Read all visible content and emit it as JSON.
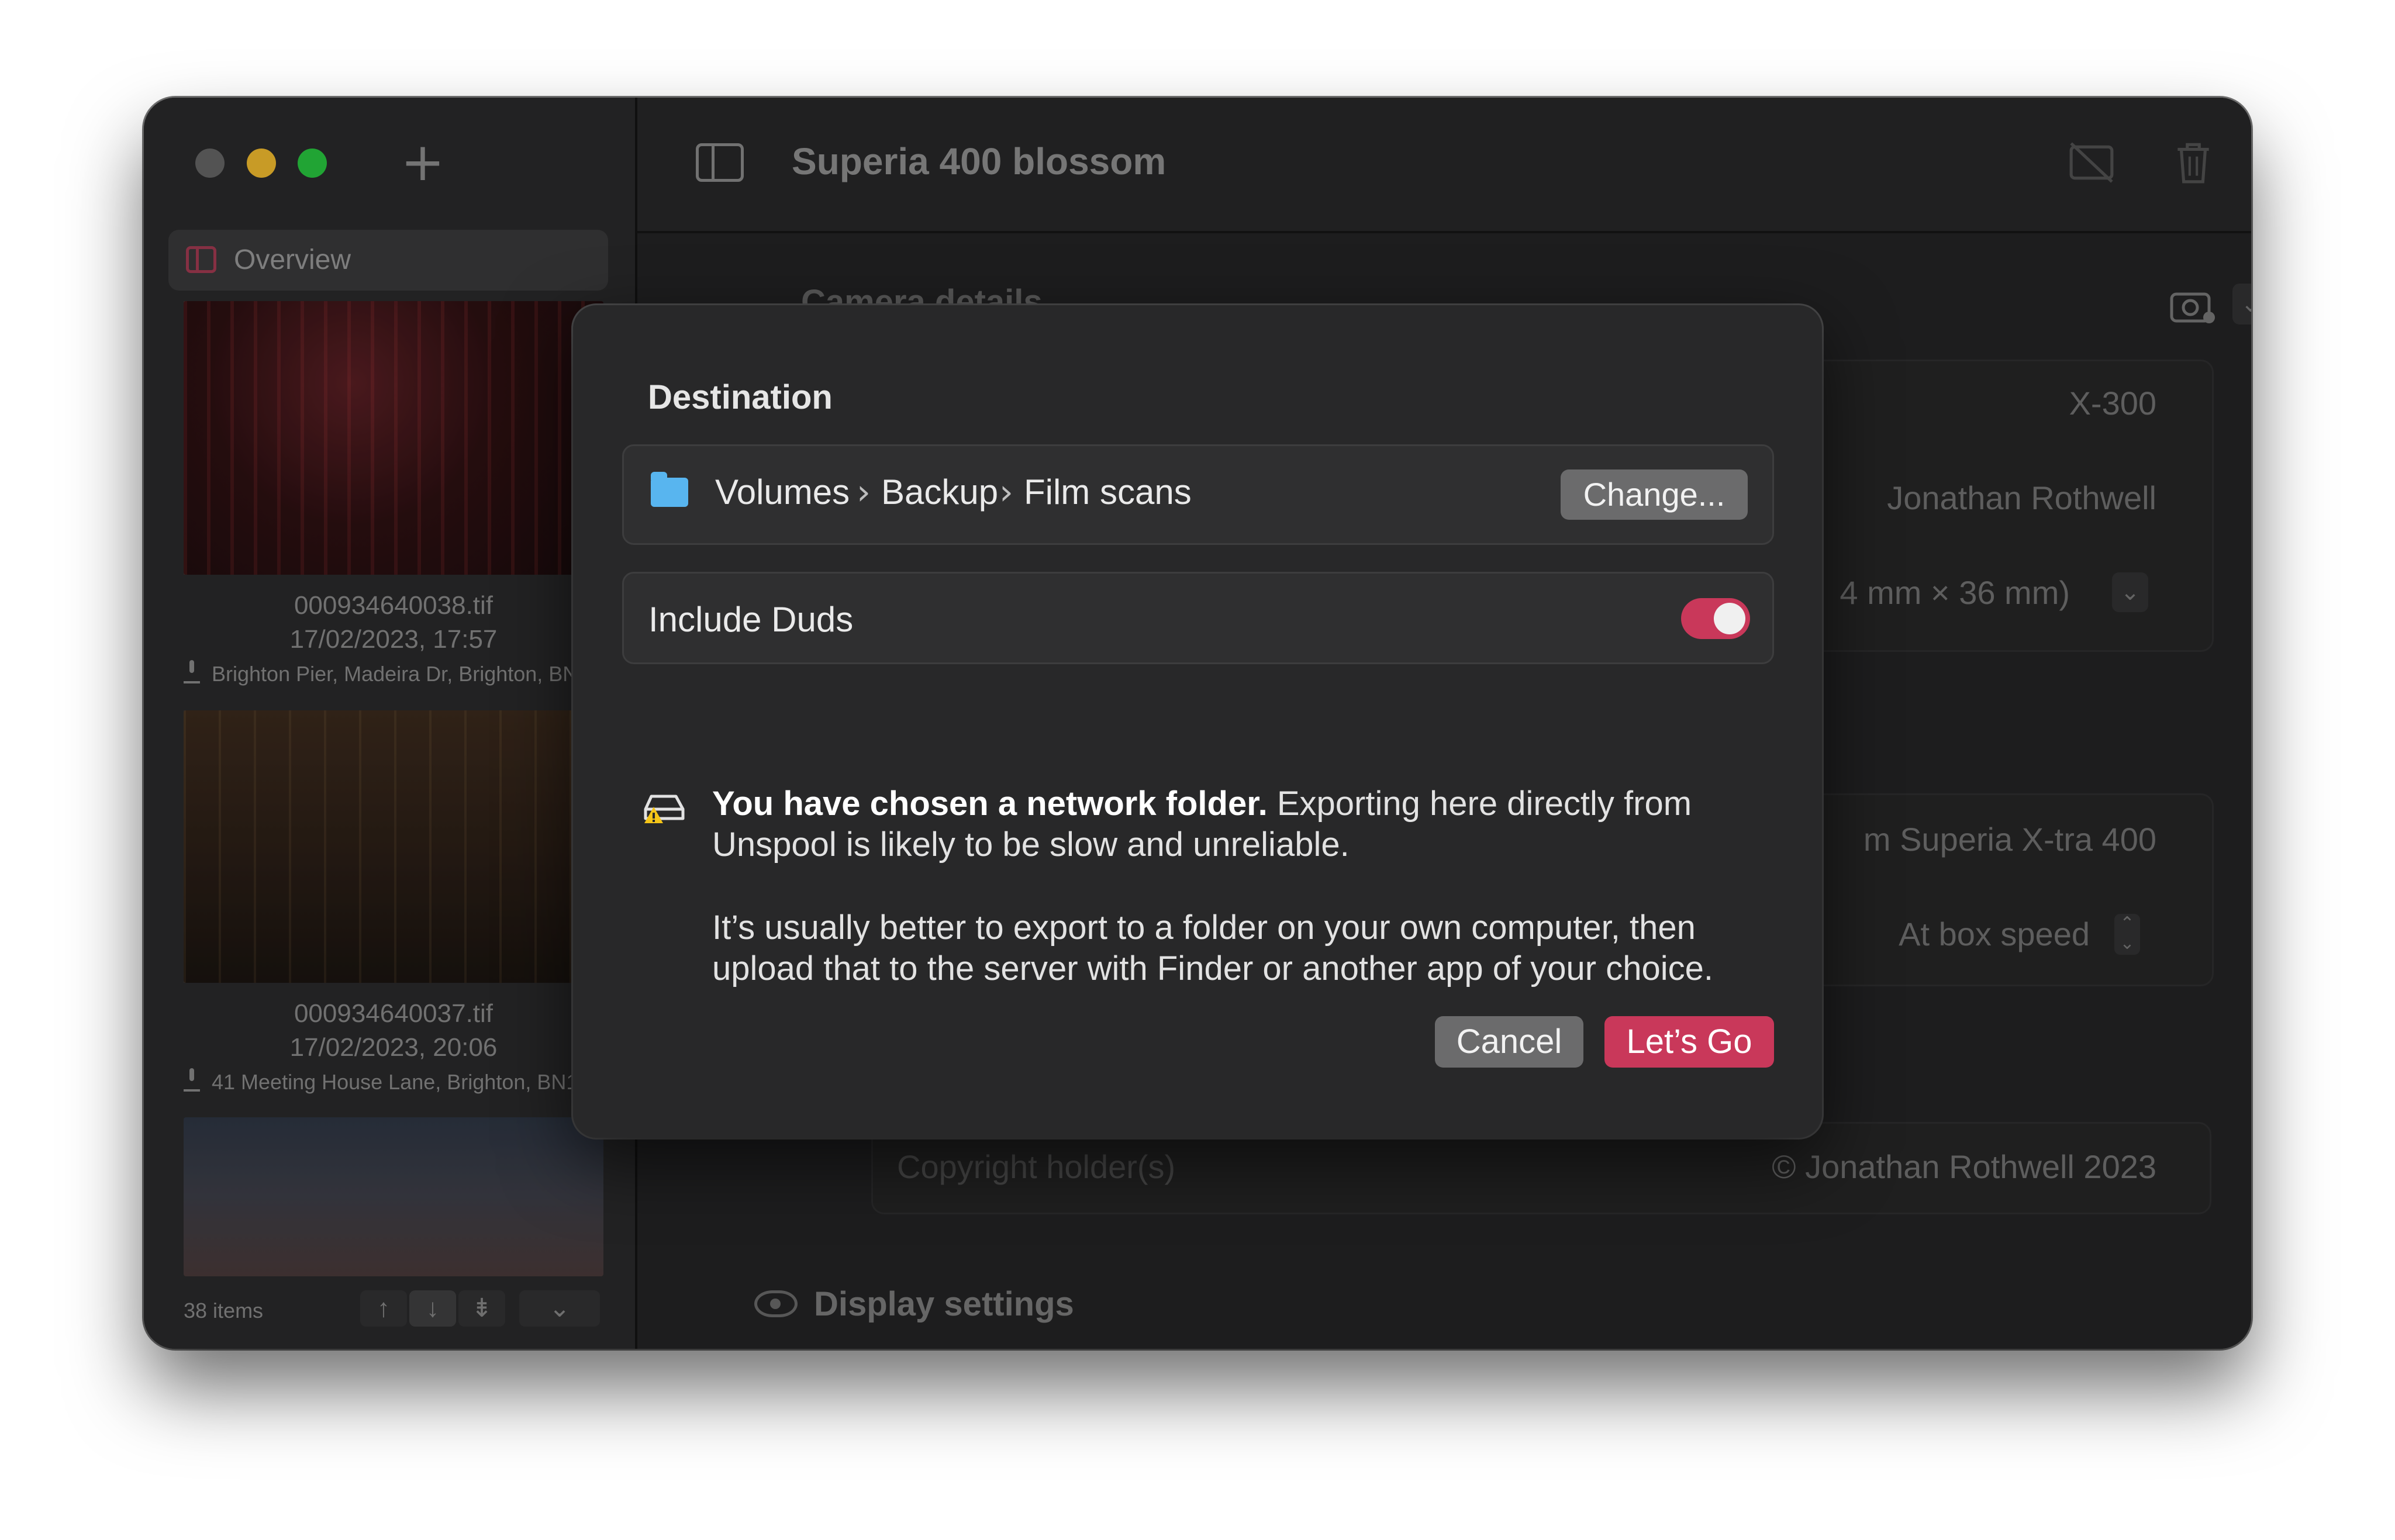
{
  "window": {
    "title": "Superia 400 blossom"
  },
  "sidebar": {
    "overview_label": "Overview",
    "items": [
      {
        "filename": "000934640038.tif",
        "datetime": "17/02/2023, 17:57",
        "location": "Brighton Pier, Madeira Dr, Brighton, BN2"
      },
      {
        "filename": "000934640037.tif",
        "datetime": "17/02/2023, 20:06",
        "location": "41 Meeting House Lane, Brighton, BN1"
      }
    ],
    "footer": {
      "count": "38 items"
    }
  },
  "background_pane": {
    "camera_section_title": "Camera details",
    "camera_model": "X-300",
    "owner": "Jonathan Rothwell",
    "format": "4 mm × 36 mm)",
    "film_stock": "m Superia X-tra 400",
    "speed": "At box speed",
    "copyright_label": "Copyright holder(s)",
    "copyright_value": "© Jonathan Rothwell 2023",
    "display_section_title": "Display settings"
  },
  "dialog": {
    "destination_heading": "Destination",
    "path": [
      "Volumes",
      "Backup",
      "Film scans"
    ],
    "change_label": "Change...",
    "include_duds_label": "Include Duds",
    "include_duds_on": true,
    "warning_bold": "You have chosen a network folder.",
    "warning_rest": " Exporting here directly from Unspool is likely to be slow and unreliable.",
    "advice": "It’s usually better to export to a folder on your own computer, then upload that to the server with Finder or another app of your choice.",
    "cancel_label": "Cancel",
    "confirm_label": "Let’s Go"
  },
  "colors": {
    "accent": "#c9385a",
    "folder": "#58b5ef",
    "warning": "#f5c518"
  }
}
